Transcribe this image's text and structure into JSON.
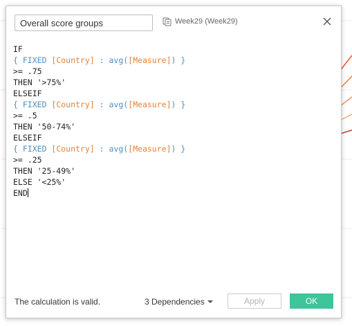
{
  "dialog": {
    "calc_name": "Overall score groups",
    "datasource_label": "Week29 (Week29)",
    "datasource_icon": "datasource-icon",
    "close_icon": "close-icon"
  },
  "editor": {
    "lines": [
      [
        {
          "t": "IF",
          "c": "plain"
        }
      ],
      [
        {
          "t": "{ FIXED ",
          "c": "func"
        },
        {
          "t": "[Country]",
          "c": "field"
        },
        {
          "t": " : ",
          "c": "func"
        },
        {
          "t": "avg(",
          "c": "func"
        },
        {
          "t": "[Measure]",
          "c": "field"
        },
        {
          "t": ") }",
          "c": "func"
        }
      ],
      [
        {
          "t": ">= .75",
          "c": "plain"
        }
      ],
      [
        {
          "t": "THEN '>75%'",
          "c": "plain"
        }
      ],
      [
        {
          "t": "ELSEIF",
          "c": "plain"
        }
      ],
      [
        {
          "t": "{ FIXED ",
          "c": "func"
        },
        {
          "t": "[Country]",
          "c": "field"
        },
        {
          "t": " : ",
          "c": "func"
        },
        {
          "t": "avg(",
          "c": "func"
        },
        {
          "t": "[Measure]",
          "c": "field"
        },
        {
          "t": ") }",
          "c": "func"
        }
      ],
      [
        {
          "t": ">= .5",
          "c": "plain"
        }
      ],
      [
        {
          "t": "THEN '50-74%'",
          "c": "plain"
        }
      ],
      [
        {
          "t": "ELSEIF",
          "c": "plain"
        }
      ],
      [
        {
          "t": "{ FIXED ",
          "c": "func"
        },
        {
          "t": "[Country]",
          "c": "field"
        },
        {
          "t": " : ",
          "c": "func"
        },
        {
          "t": "avg(",
          "c": "func"
        },
        {
          "t": "[Measure]",
          "c": "field"
        },
        {
          "t": ") }",
          "c": "func"
        }
      ],
      [
        {
          "t": ">= .25",
          "c": "plain"
        }
      ],
      [
        {
          "t": "THEN '25-49%'",
          "c": "plain"
        }
      ],
      [
        {
          "t": "ELSE '<25%'",
          "c": "plain"
        }
      ],
      [
        {
          "t": "END",
          "c": "plain"
        }
      ]
    ]
  },
  "footer": {
    "status": "The calculation is valid.",
    "dependencies": "3 Dependencies",
    "apply_label": "Apply",
    "ok_label": "OK"
  },
  "colors": {
    "function": "#4f8fc2",
    "field": "#e0833a",
    "ok_button": "#3ec59a",
    "background_lines": "#e8542c"
  }
}
